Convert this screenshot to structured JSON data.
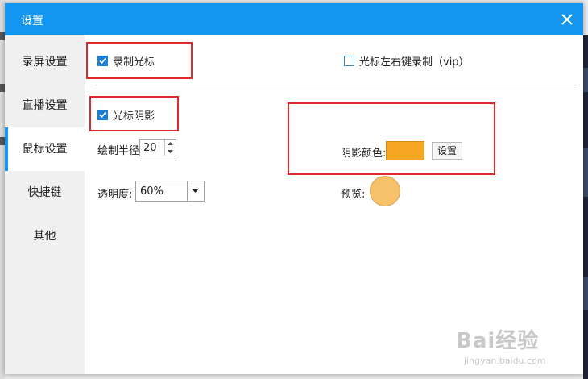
{
  "window": {
    "title": "设置"
  },
  "sidebar": {
    "items": [
      {
        "label": "录屏设置"
      },
      {
        "label": "直播设置"
      },
      {
        "label": "鼠标设置"
      },
      {
        "label": "快捷键"
      },
      {
        "label": "其他"
      }
    ],
    "active_index": 2
  },
  "mouse_settings": {
    "record_cursor": {
      "label": "录制光标",
      "checked": true
    },
    "record_clicks": {
      "label": "光标左右键录制（vip）",
      "checked": false
    },
    "cursor_shadow": {
      "label": "光标阴影",
      "checked": true
    },
    "draw_radius": {
      "label": "绘制半径:",
      "value": "20"
    },
    "opacity": {
      "label": "透明度:",
      "value": "60%"
    },
    "shadow_color": {
      "label": "阴影颜色:",
      "color": "#f5a623",
      "button_label": "设置"
    },
    "preview": {
      "label": "预览:",
      "color": "#f7c16a"
    }
  },
  "watermark": {
    "main": "Bai经验",
    "sub": "jingyan.baidu.com"
  },
  "colors": {
    "accent": "#1296f0",
    "highlight": "#e02a2a"
  }
}
